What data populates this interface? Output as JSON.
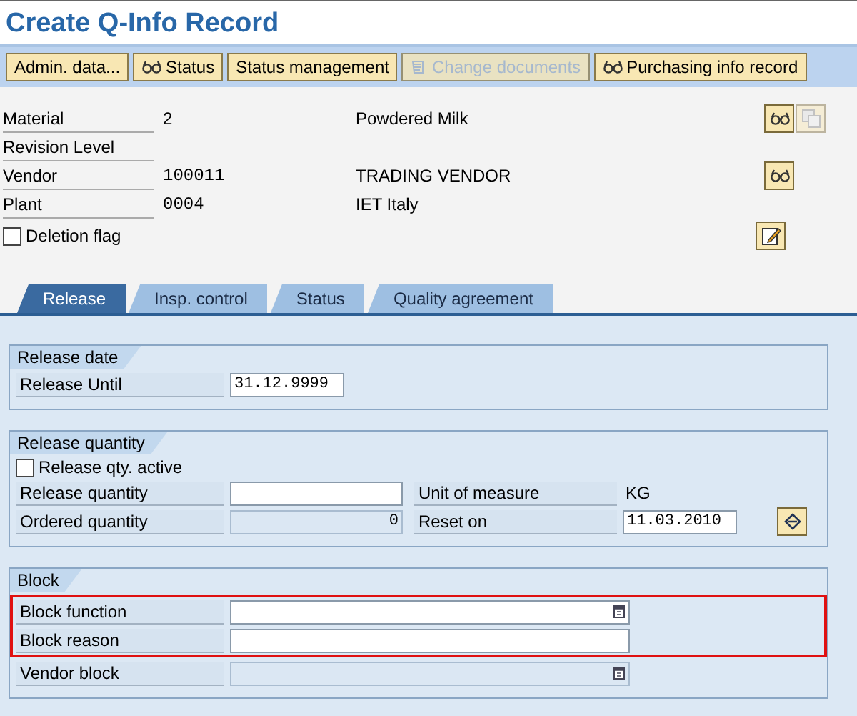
{
  "title": "Create Q-Info Record",
  "toolbar": [
    {
      "label": "Admin. data...",
      "disabled": false
    },
    {
      "label": "Status",
      "disabled": false
    },
    {
      "label": "Status management",
      "disabled": false
    },
    {
      "label": "Change documents",
      "disabled": true
    },
    {
      "label": "Purchasing info record",
      "disabled": false
    }
  ],
  "header": {
    "rows": [
      {
        "label": "Material",
        "value": "2",
        "mono": false,
        "description": "Powdered Milk",
        "buttons": [
          {
            "kind": "display",
            "disabled": false
          },
          {
            "kind": "copy",
            "disabled": true
          }
        ]
      },
      {
        "label": "Revision Level"
      },
      {
        "label": "Vendor",
        "value": "100011",
        "mono": true,
        "description": "TRADING VENDOR",
        "buttons": [
          {
            "kind": "display",
            "disabled": false
          }
        ]
      },
      {
        "label": "Plant",
        "value": "0004",
        "mono": true,
        "description": "IET Italy"
      }
    ],
    "deletion_flag": {
      "label": "Deletion flag",
      "checked": false,
      "buttons": [
        {
          "kind": "edit",
          "disabled": false
        }
      ]
    }
  },
  "tabs": [
    {
      "label": "Release",
      "selected": true
    },
    {
      "label": "Insp. control",
      "selected": false
    },
    {
      "label": "Status",
      "selected": false
    },
    {
      "label": "Quality agreement",
      "selected": false
    }
  ],
  "groups": [
    {
      "title": "Release date",
      "rows": [
        {
          "cells": [
            {
              "label": "Release Until",
              "kind": "input",
              "value": "31.12.9999"
            }
          ]
        }
      ]
    },
    {
      "title": "Release quantity",
      "checkbox": {
        "label": "Release qty. active",
        "checked": false
      },
      "rows": [
        {
          "cells": [
            {
              "label": "Release quantity",
              "kind": "input"
            },
            {
              "label": "Unit of measure",
              "kind": "text",
              "value": "KG"
            }
          ]
        },
        {
          "cells": [
            {
              "label": "Ordered quantity",
              "kind": "display",
              "value": "0"
            },
            {
              "label": "Reset on",
              "kind": "readonly",
              "value": "11.03.2010"
            }
          ]
        }
      ]
    },
    {
      "title": "Block",
      "rows": [
        {
          "highlighted": true,
          "cells": [
            {
              "label": "Block function",
              "kind": "input",
              "help": true
            }
          ]
        },
        {
          "highlighted": true,
          "cells": [
            {
              "label": "Block reason",
              "kind": "input",
              "help": false
            }
          ]
        },
        {
          "highlighted": false,
          "cells": [
            {
              "label": "Vendor block",
              "kind": "display",
              "help": true
            }
          ]
        }
      ]
    }
  ]
}
